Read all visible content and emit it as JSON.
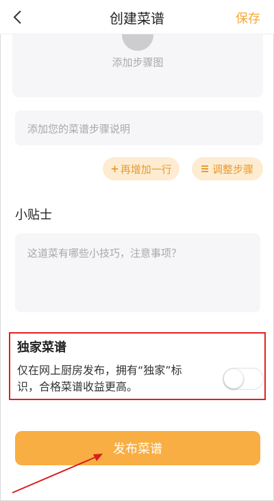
{
  "header": {
    "title": "创建菜谱",
    "save_label": "保存",
    "back_icon": "chevron-left-icon"
  },
  "step": {
    "add_image_label": "添加步骤图",
    "description_placeholder": "添加您的菜谱步骤说明",
    "add_row_label": "再增加一行",
    "add_row_prefix": "+",
    "adjust_label": "调整步骤"
  },
  "tips": {
    "heading": "小贴士",
    "placeholder": "这道菜有哪些小技巧，注意事项？"
  },
  "exclusive": {
    "title": "独家菜谱",
    "description": "仅在网上厨房发布，拥有“独家”标识，合格菜谱收益更高。",
    "toggle_on": false
  },
  "publish": {
    "label": "发布菜谱"
  },
  "colors": {
    "accent": "#f5a833",
    "publish_button": "#f8ae43",
    "pill_background": "#fdecd2",
    "highlight_border": "#e02020",
    "annotation_arrow": "#d81e1e"
  }
}
